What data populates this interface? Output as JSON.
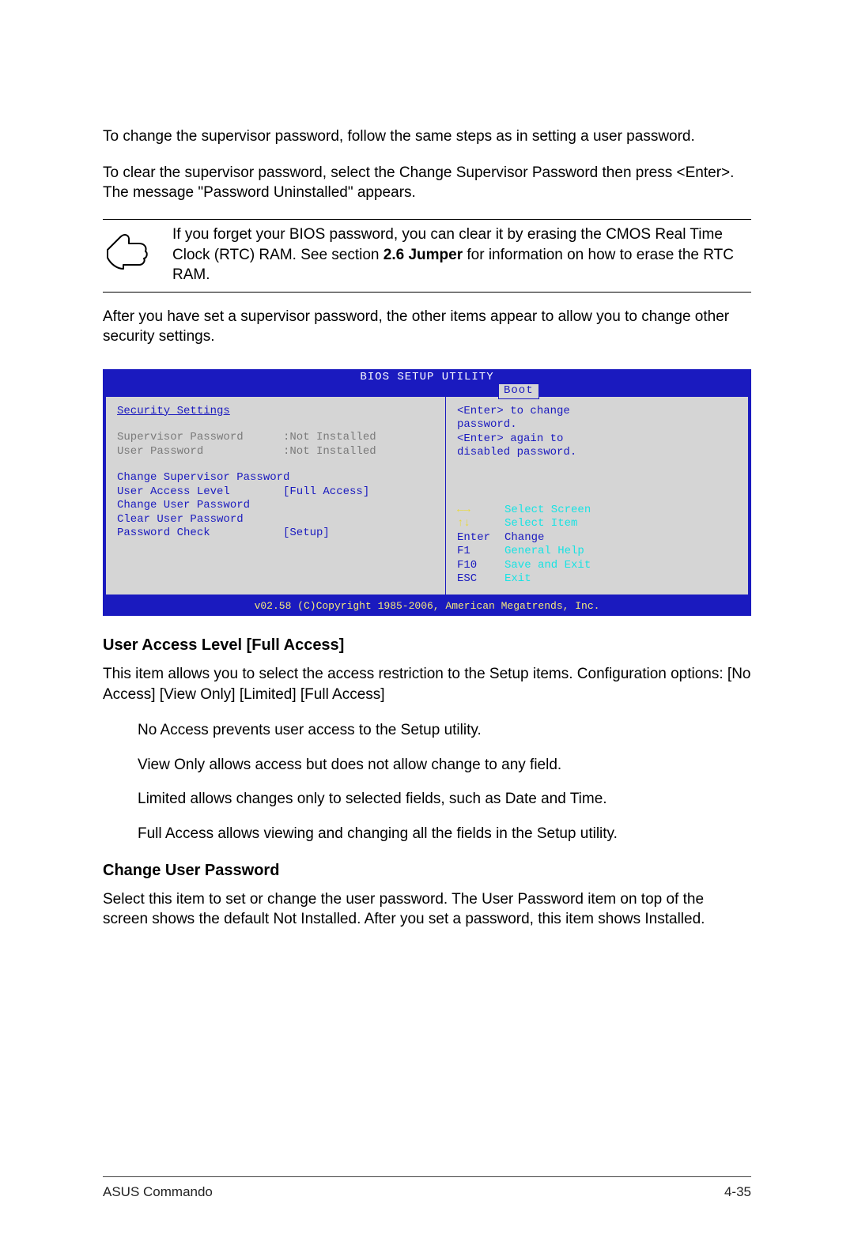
{
  "para_change": "To change the supervisor password, follow the same steps as in setting a user password.",
  "para_clear": "To clear the supervisor password, select the Change Supervisor Password then press <Enter>. The message \"Password Uninstalled\" appears.",
  "note": {
    "pre": "If you forget your BIOS password, you can clear it by erasing the CMOS Real Time Clock (RTC) RAM. See section ",
    "bold": "2.6 Jumper",
    "post": " for information on how to erase the RTC RAM."
  },
  "para_after": "After you have set a supervisor password, the other items appear to allow you to change other security settings.",
  "bios": {
    "title": "BIOS SETUP UTILITY",
    "tab": "Boot",
    "section": "Security Settings",
    "status": [
      {
        "label": "Supervisor Password",
        "value": ":Not Installed"
      },
      {
        "label": "User Password",
        "value": ":Not Installed"
      }
    ],
    "items": [
      {
        "label": "Change Supervisor Password",
        "value": ""
      },
      {
        "label": "User Access Level",
        "value": "[Full Access]"
      },
      {
        "label": "Change User Password",
        "value": ""
      },
      {
        "label": "Clear User Password",
        "value": ""
      },
      {
        "label": "Password Check",
        "value": "[Setup]"
      }
    ],
    "help": {
      "l1": "<Enter> to change",
      "l2": "password.",
      "l3": "<Enter> again to",
      "l4": "disabled password."
    },
    "legend": [
      {
        "key": "←→",
        "text": "Select Screen",
        "key_class": "yellow",
        "txt_class": "cyan"
      },
      {
        "key": "↑↓",
        "text": "Select Item",
        "key_class": "yellow",
        "txt_class": "cyan"
      },
      {
        "key": "Enter",
        "text": "Change",
        "key_class": "blue",
        "txt_class": "blue"
      },
      {
        "key": "F1",
        "text": "General Help",
        "key_class": "blue",
        "txt_class": "cyan"
      },
      {
        "key": "F10",
        "text": "Save and Exit",
        "key_class": "blue",
        "txt_class": "cyan"
      },
      {
        "key": "ESC",
        "text": "Exit",
        "key_class": "blue",
        "txt_class": "cyan"
      }
    ],
    "footer": "v02.58 (C)Copyright 1985-2006, American Megatrends, Inc."
  },
  "ual_heading": "User Access Level [Full Access]",
  "ual_p1": "This item allows you to select the access restriction to the Setup items. Configuration options: [No Access] [View Only] [Limited] [Full Access]",
  "ual_items": [
    "No Access prevents user access to the Setup utility.",
    "View Only allows access but does not allow change to any field.",
    "Limited allows changes only to selected fields, such as Date and Time.",
    "Full Access allows viewing and changing all the fields in the Setup utility."
  ],
  "cup_heading": "Change User Password",
  "cup_p": "Select this item to set or change the user password. The User Password item on top of the screen shows the default Not Installed. After you set a password, this item shows Installed.",
  "footer_left": "ASUS Commando",
  "footer_right": "4-35"
}
